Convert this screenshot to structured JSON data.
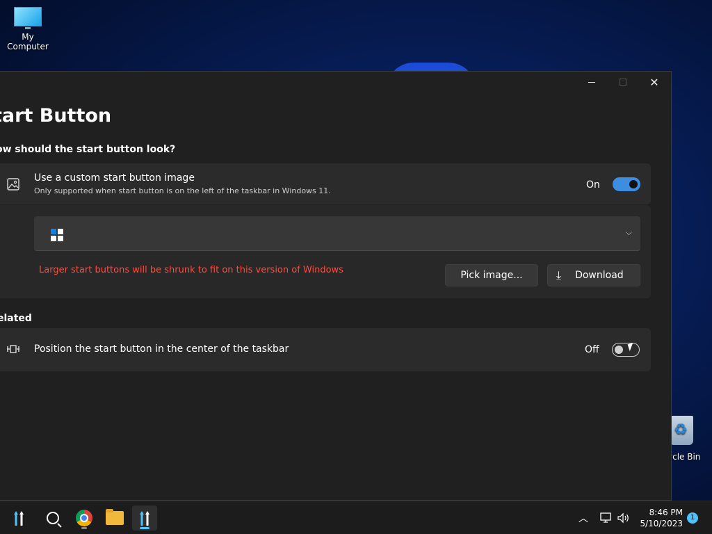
{
  "desktop": {
    "icons": [
      {
        "label": "My Computer"
      },
      {
        "label": "ycle Bin"
      }
    ]
  },
  "window": {
    "title": "tart Button",
    "section_look": "ow should the start button look?",
    "custom_image": {
      "title": "Use a custom start button image",
      "subtitle": "Only supported when start button is on the left of the taskbar in Windows 11.",
      "state": "On"
    },
    "dropdown": {
      "chevron": "⌵"
    },
    "warning": "Larger start buttons will be shrunk to fit on this version of Windows",
    "pick_image_label": "Pick image...",
    "download_label": "Download",
    "section_related": "elated",
    "center_position": {
      "title": "Position the start button in the center of the taskbar",
      "state": "Off"
    }
  },
  "taskbar": {
    "time": "8:46 PM",
    "date": "5/10/2023",
    "notification_count": "1"
  },
  "colors": {
    "accent": "#3d8ee0",
    "warning": "#ff4b3e",
    "window_bg": "#202020",
    "card_bg": "#2b2b2b"
  }
}
